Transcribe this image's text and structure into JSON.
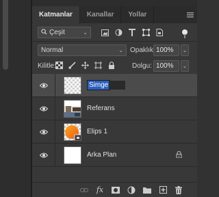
{
  "tabs": [
    {
      "label": "Katmanlar",
      "active": true
    },
    {
      "label": "Kanallar",
      "active": false
    },
    {
      "label": "Yollar",
      "active": false
    }
  ],
  "tab_menu_icon": "menu-icon",
  "filter": {
    "kind_label": "Çeşit",
    "icons": [
      "pixel-filter-icon",
      "adjustment-filter-icon",
      "type-filter-icon",
      "shape-filter-icon",
      "smart-object-filter-icon"
    ]
  },
  "blend": {
    "mode": "Normal",
    "opacity_label": "Opaklık:",
    "opacity_value": "100%"
  },
  "lock": {
    "label": "Kilitle:",
    "icons": [
      "lock-transparent-icon",
      "lock-paint-icon",
      "lock-move-icon",
      "lock-artboard-icon",
      "lock-all-icon"
    ],
    "fill_label": "Dolgu:",
    "fill_value": "100%"
  },
  "layers": [
    {
      "name": "Simge",
      "thumb": "transparent",
      "selected": true,
      "editing": true,
      "locked": false
    },
    {
      "name": "Referans",
      "thumb": "photo",
      "selected": false,
      "editing": false,
      "locked": false
    },
    {
      "name": "Elips 1",
      "thumb": "ellipse",
      "selected": false,
      "editing": false,
      "locked": false
    },
    {
      "name": "Arka Plan",
      "thumb": "white",
      "selected": false,
      "editing": false,
      "locked": true
    }
  ],
  "footer_icons": [
    "link-layers-icon",
    "fx-icon",
    "add-mask-icon",
    "adjustment-layer-icon",
    "new-group-icon",
    "new-layer-icon",
    "delete-layer-icon"
  ]
}
